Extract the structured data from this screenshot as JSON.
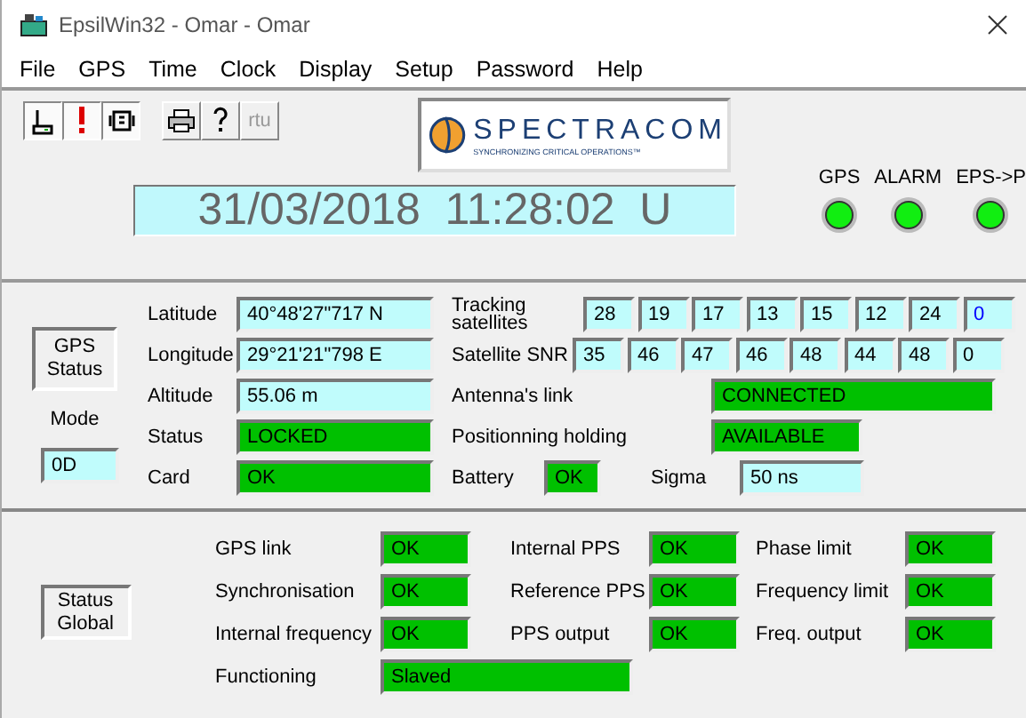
{
  "window": {
    "title": "EpsilWin32 - Omar - Omar"
  },
  "menu": [
    "File",
    "GPS",
    "Time",
    "Clock",
    "Display",
    "Setup",
    "Password",
    "Help"
  ],
  "toolbar": [
    {
      "kind": "device",
      "pressed": true
    },
    {
      "kind": "alert",
      "pressed": true
    },
    {
      "kind": "radio",
      "pressed": true
    },
    {
      "kind": "printer",
      "pressed": false
    },
    {
      "kind": "help",
      "pressed": false
    },
    {
      "kind": "text",
      "label": "rtu",
      "pressed": false,
      "disabled": true
    }
  ],
  "logo": {
    "name": "SPECTRACOM",
    "tagline": "SYNCHRONIZING CRITICAL OPERATIONS™"
  },
  "clock": {
    "date": "31/03/2018",
    "time": "11:28:02",
    "zone": "U"
  },
  "indicators": [
    {
      "label": "GPS",
      "on": true
    },
    {
      "label": "ALARM",
      "on": true
    },
    {
      "label": "EPS->P",
      "on": true
    }
  ],
  "gps_panel": {
    "button": "GPS Status",
    "mode_label": "Mode",
    "mode": "0D",
    "fields": [
      {
        "label": "Latitude",
        "value": "40°48'27\"717 N",
        "kind": "text"
      },
      {
        "label": "Longitude",
        "value": "29°21'21\"798 E",
        "kind": "text"
      },
      {
        "label": "Altitude",
        "value": "55.06 m",
        "kind": "text"
      },
      {
        "label": "Status",
        "value": "LOCKED",
        "kind": "status"
      },
      {
        "label": "Card",
        "value": "OK",
        "kind": "status"
      }
    ],
    "tracking": {
      "label": "Tracking satellites",
      "values": [
        {
          "value": "28",
          "color": "#000000"
        },
        {
          "value": "19",
          "color": "#000000"
        },
        {
          "value": "17",
          "color": "#000000"
        },
        {
          "value": "13",
          "color": "#000000"
        },
        {
          "value": "15",
          "color": "#000000"
        },
        {
          "value": "12",
          "color": "#000000"
        },
        {
          "value": "24",
          "color": "#000000"
        },
        {
          "value": "0",
          "color": "#0000ff"
        }
      ]
    },
    "snr": {
      "label": "Satellite SNR",
      "values": [
        "35",
        "46",
        "47",
        "46",
        "48",
        "44",
        "48",
        "0"
      ]
    },
    "antenna": {
      "label": "Antenna's link",
      "value": "CONNECTED",
      "kind": "status"
    },
    "positioning": {
      "label": "Positionning holding",
      "value": "AVAILABLE",
      "kind": "status"
    },
    "battery": {
      "label": "Battery",
      "value": "OK",
      "kind": "status"
    },
    "sigma": {
      "label": "Sigma",
      "value": "50 ns",
      "kind": "text"
    }
  },
  "status_panel": {
    "button": "Status Global",
    "items": [
      {
        "label": "GPS link",
        "value": "OK",
        "kind": "status"
      },
      {
        "label": "Internal PPS",
        "value": "OK",
        "kind": "status"
      },
      {
        "label": "Phase limit",
        "value": "OK",
        "kind": "status"
      },
      {
        "label": "Synchronisation",
        "value": "OK",
        "kind": "status"
      },
      {
        "label": "Reference PPS",
        "value": "OK",
        "kind": "status"
      },
      {
        "label": "Frequency limit",
        "value": "OK",
        "kind": "status"
      },
      {
        "label": "Internal frequency",
        "value": "OK",
        "kind": "status"
      },
      {
        "label": "PPS output",
        "value": "OK",
        "kind": "status"
      },
      {
        "label": "Freq. output",
        "value": "OK",
        "kind": "status"
      }
    ],
    "functioning": {
      "label": "Functioning",
      "value": "Slaved",
      "kind": "status"
    }
  }
}
